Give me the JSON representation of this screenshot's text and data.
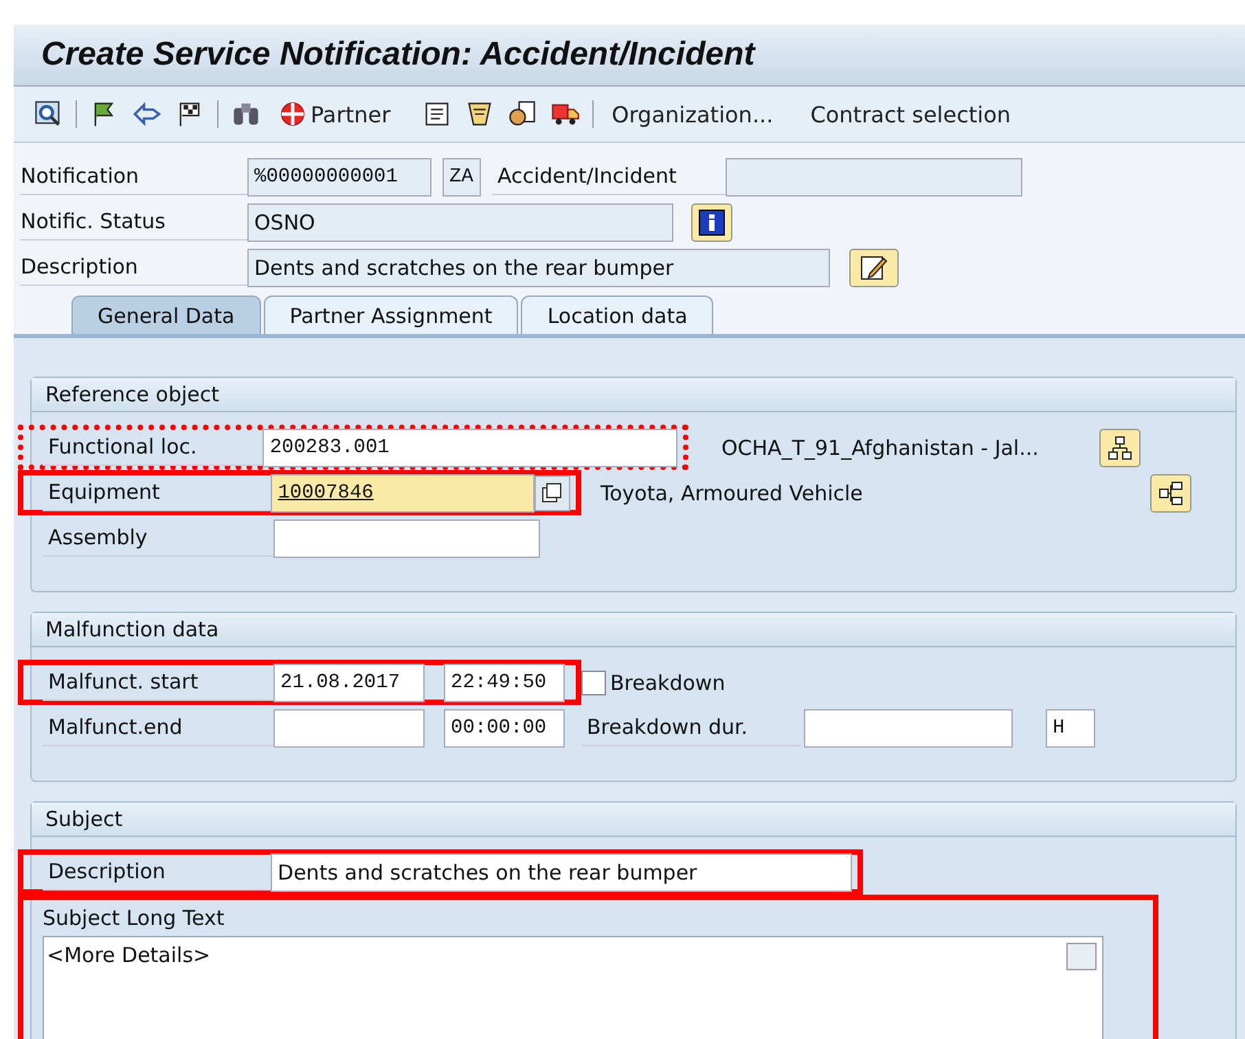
{
  "window": {
    "title": "Create Service Notification: Accident/Incident"
  },
  "toolbar": {
    "buttons": [
      "Partner",
      "Organization...",
      "Contract selection"
    ]
  },
  "header": {
    "notification": {
      "label": "Notification",
      "value": "%00000000001",
      "type": "ZA",
      "type_text": "Accident/Incident"
    },
    "status": {
      "label": "Notific. Status",
      "value": "OSNO"
    },
    "description": {
      "label": "Description",
      "value": "Dents and scratches on the rear bumper"
    }
  },
  "tabs": [
    {
      "label": "General Data",
      "selected": true
    },
    {
      "label": "Partner Assignment",
      "selected": false
    },
    {
      "label": "Location data",
      "selected": false
    }
  ],
  "reference": {
    "title": "Reference object",
    "functional_loc": {
      "label": "Functional loc.",
      "value": "200283.001",
      "text": "OCHA_T_91_Afghanistan - Jal...",
      "highlighted": true,
      "dotted": true
    },
    "equipment": {
      "label": "Equipment",
      "value": "10007846",
      "text": "Toyota, Armoured Vehicle",
      "highlighted": true
    },
    "assembly": {
      "label": "Assembly"
    }
  },
  "malfunction": {
    "title": "Malfunction data",
    "start": {
      "label": "Malfunct. start",
      "date": "21.08.2017",
      "time": "22:49:50",
      "highlighted": true
    },
    "breakdown": {
      "label": "Breakdown",
      "checked": false
    },
    "end": {
      "label": "Malfunct.end",
      "time": "00:00:00"
    },
    "duration": {
      "label": "Breakdown dur.",
      "unit": "H"
    }
  },
  "subject": {
    "title": "Subject",
    "description": {
      "label": "Description",
      "value": "Dents and scratches on the rear bumper",
      "highlighted": true
    },
    "long_text": {
      "label": "Subject Long Text",
      "value": "<More Details>",
      "highlighted": true
    }
  }
}
